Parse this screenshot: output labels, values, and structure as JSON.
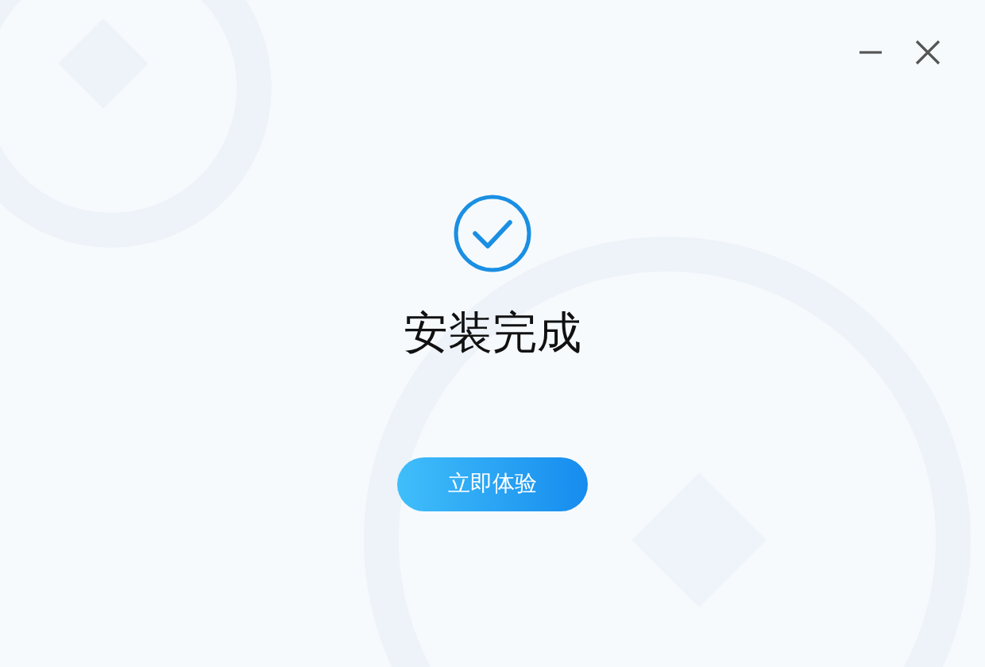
{
  "title": "安装完成",
  "button": {
    "label": "立即体验"
  }
}
